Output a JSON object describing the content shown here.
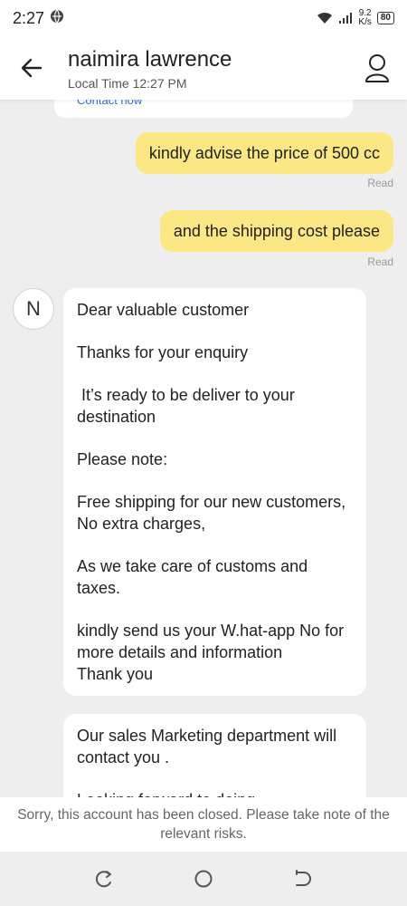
{
  "status_bar": {
    "time": "2:27",
    "net_speed_value": "9.2",
    "net_speed_unit": "K/s",
    "battery": "80"
  },
  "header": {
    "contact_name": "naimira lawrence",
    "local_time": "Local Time 12:27 PM"
  },
  "chat": {
    "previous_card_link": "Contact now",
    "outgoing": [
      {
        "text": "kindly advise the price of 500 cc",
        "status": "Read"
      },
      {
        "text": "and the shipping cost please",
        "status": "Read"
      }
    ],
    "avatar_letter": "N",
    "incoming": [
      {
        "paragraphs": [
          "Dear valuable customer",
          "Thanks for your enquiry",
          " It’s ready to be deliver to your destination",
          "Please note:",
          "Free shipping for our new customers, No extra charges,",
          "As we take care of customs and taxes.",
          "kindly send us your W.hat-app No for more details and information\nThank you"
        ]
      },
      {
        "paragraphs": [
          "Our sales Marketing department will contact you .",
          "Looking forward to doing"
        ]
      }
    ]
  },
  "closed_notice": "Sorry, this account has been closed. Please take note of the relevant risks.",
  "colors": {
    "outgoing_bubble": "#fce785",
    "background": "#eeeeee",
    "link": "#2b6fd6"
  }
}
